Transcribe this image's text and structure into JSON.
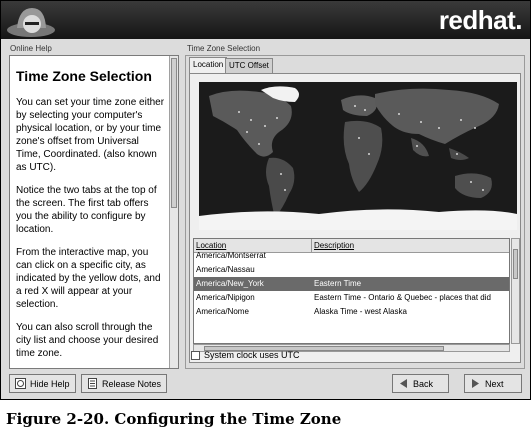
{
  "banner": {
    "brand": "redhat."
  },
  "help": {
    "section_label": "Online Help",
    "title": "Time Zone Selection",
    "paragraphs": [
      "You can set your time zone either by selecting your computer's physical location, or by your time zone's offset from Universal Time, Coordinated. (also known as UTC).",
      "Notice the two tabs at the top of the screen. The first tab offers you the ability to configure by location.",
      "From the interactive map, you can click on a specific city, as indicated by the yellow dots, and a red X will appear at your selection.",
      "You can also scroll through the city list and choose your desired time zone."
    ]
  },
  "tz": {
    "section_label": "Time Zone Selection",
    "tabs": [
      "Location",
      "UTC Offset"
    ],
    "columns": [
      "Location",
      "Description"
    ],
    "rows": [
      {
        "location": "America/Montserrat",
        "description": ""
      },
      {
        "location": "America/Nassau",
        "description": ""
      },
      {
        "location": "America/New_York",
        "description": "Eastern Time",
        "selected": true
      },
      {
        "location": "America/Nipigon",
        "description": "Eastern Time - Ontario & Quebec - places that did"
      },
      {
        "location": "America/Nome",
        "description": "Alaska Time - west Alaska"
      }
    ],
    "utc_checkbox": {
      "label": "System clock uses UTC",
      "checked": false
    }
  },
  "buttons": {
    "hide_help": "Hide Help",
    "release_notes": "Release Notes",
    "back": "Back",
    "next": "Next"
  },
  "caption": "Figure 2-20. Configuring the Time Zone",
  "colors": {
    "banner": "#1a1a1a",
    "selected_row": "#6a6a6a",
    "map_ocean": "#1a1a1a"
  }
}
